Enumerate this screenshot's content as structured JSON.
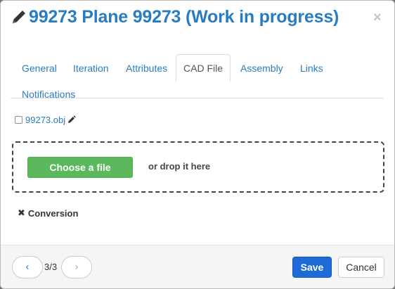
{
  "header": {
    "title": "99273 Plane 99273 (Work in progress)",
    "title_icon": "pencil-icon",
    "close_label": "×"
  },
  "tabs": [
    {
      "label": "General",
      "active": false
    },
    {
      "label": "Iteration",
      "active": false
    },
    {
      "label": "Attributes",
      "active": false
    },
    {
      "label": "CAD File",
      "active": true
    },
    {
      "label": "Assembly",
      "active": false
    },
    {
      "label": "Links",
      "active": false
    },
    {
      "label": "Notifications",
      "active": false
    }
  ],
  "file": {
    "name": "99273.obj",
    "checked": false,
    "edit_icon": "pencil-icon"
  },
  "dropzone": {
    "choose_label": "Choose a file",
    "drop_text": "or drop it here"
  },
  "conversion": {
    "icon": "x-icon",
    "label": "Conversion"
  },
  "footer": {
    "prev_label": "‹",
    "next_label": "›",
    "page_count": "3/3",
    "save_label": "Save",
    "cancel_label": "Cancel"
  },
  "colors": {
    "link": "#2a7cc0",
    "primary": "#1e6ad6",
    "success": "#5cb85c"
  }
}
